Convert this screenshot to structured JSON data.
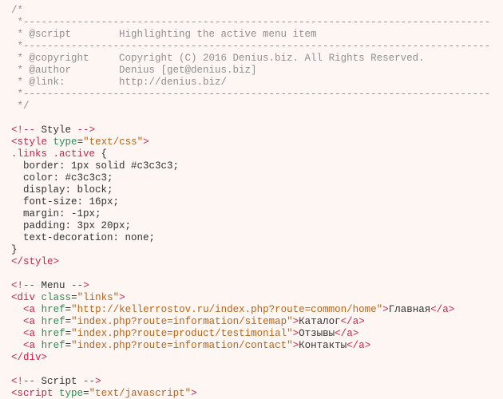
{
  "c00": "/*",
  "c01": " *------------------------------------------------------------------------------",
  "c02": " * @script        Highlighting the active menu item",
  "c03": " *------------------------------------------------------------------------------",
  "c04": " * @copyright     Copyright (C) 2016 Denius.biz. All Rights Reserved.",
  "c05": " * @author        Denius [get@denius.biz]",
  "c06": " * @link:         http://denius.biz/",
  "c07": " *------------------------------------------------------------------------------",
  "c08": " */",
  "lt": "<",
  "gt": ">",
  "lts": "</",
  "excl": "!--",
  "dashdash": "--",
  "sp": " ",
  "styleword": " Style ",
  "menuword": " Menu ",
  "scriptword": " Script ",
  "tag_style": "style",
  "tag_div": "div",
  "tag_a": "a",
  "tag_script": "script",
  "attr_type": "type",
  "attr_class": "class",
  "attr_href": "href",
  "val_textcss": "\"text/css\"",
  "val_textjs": "\"text/javascript\"",
  "val_links": "\"links\"",
  "sel": ".links .active",
  "brace_o": " {",
  "brace_c": "}",
  "r1": "  border: 1px solid #c3c3c3;",
  "r2": "  color: #c3c3c3;",
  "r3": "  display: block;",
  "r4": "  font-size: 16px;",
  "r5": "  margin: -1px;",
  "r6": "  padding: 3px 20px;",
  "r7": "  text-decoration: none;",
  "href1": "\"http://kellerrostov.ru/index.php?route=common/home\"",
  "href2": "\"index.php?route=information/sitemap\"",
  "href3": "\"index.php?route=product/testimonial\"",
  "href4": "\"index.php?route=information/contact\"",
  "txt1": "Главная",
  "txt2": "Каталог",
  "txt3": "Отзывы",
  "txt4": "Контакты",
  "eq": "="
}
